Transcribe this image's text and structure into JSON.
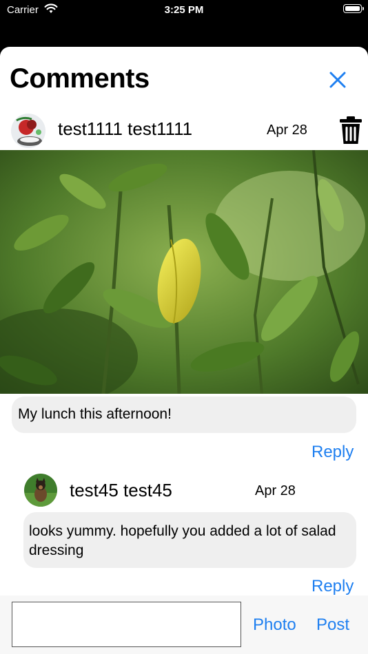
{
  "status_bar": {
    "carrier": "Carrier",
    "time": "3:25 PM"
  },
  "sheet": {
    "title": "Comments",
    "close_icon": "close-icon"
  },
  "post": {
    "author": "test1111 test1111",
    "date": "Apr 28",
    "caption": "My lunch this afternoon!",
    "reply_label": "Reply",
    "delete_icon": "trash-icon"
  },
  "comments": [
    {
      "author": "test45 test45",
      "date": "Apr 28",
      "text": "looks yummy. hopefully you added a lot of salad dressing",
      "reply_label": "Reply"
    }
  ],
  "composer": {
    "placeholder": "",
    "photo_label": "Photo",
    "post_label": "Post"
  },
  "colors": {
    "accent": "#1e7ff0",
    "bubble": "#efefef",
    "composer_bg": "#f7f7f7"
  }
}
